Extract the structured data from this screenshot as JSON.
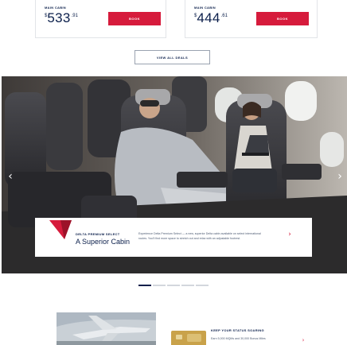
{
  "deals": [
    {
      "cabin": "MAIN CABIN",
      "currency": "$",
      "price_whole": "533",
      "price_cents": ".91",
      "book_label": "BOOK"
    },
    {
      "cabin": "MAIN CABIN",
      "currency": "$",
      "price_whole": "444",
      "price_cents": ".61",
      "book_label": "BOOK"
    }
  ],
  "view_all_label": "VIEW ALL DEALS",
  "hero": {
    "prev_icon": "‹",
    "next_icon": "›",
    "eyebrow": "DELTA PREMIUM SELECT",
    "headline": "A Superior Cabin",
    "body": "Experience Delta Premium Select — a new, superior Delta cabin available on select international routes. You'll find more space to stretch out and relax with an adjustable footrest.",
    "cta_icon": "›",
    "active_slide": 0,
    "slide_count": 5
  },
  "promo": {
    "eyebrow": "KEEP YOUR STATUS SOARING",
    "text": "Earn 5,000 MQMs and 30,000 Bonus Miles",
    "cta_icon": "›"
  },
  "colors": {
    "brand_red": "#d61b3c",
    "navy": "#0b1f4b"
  }
}
